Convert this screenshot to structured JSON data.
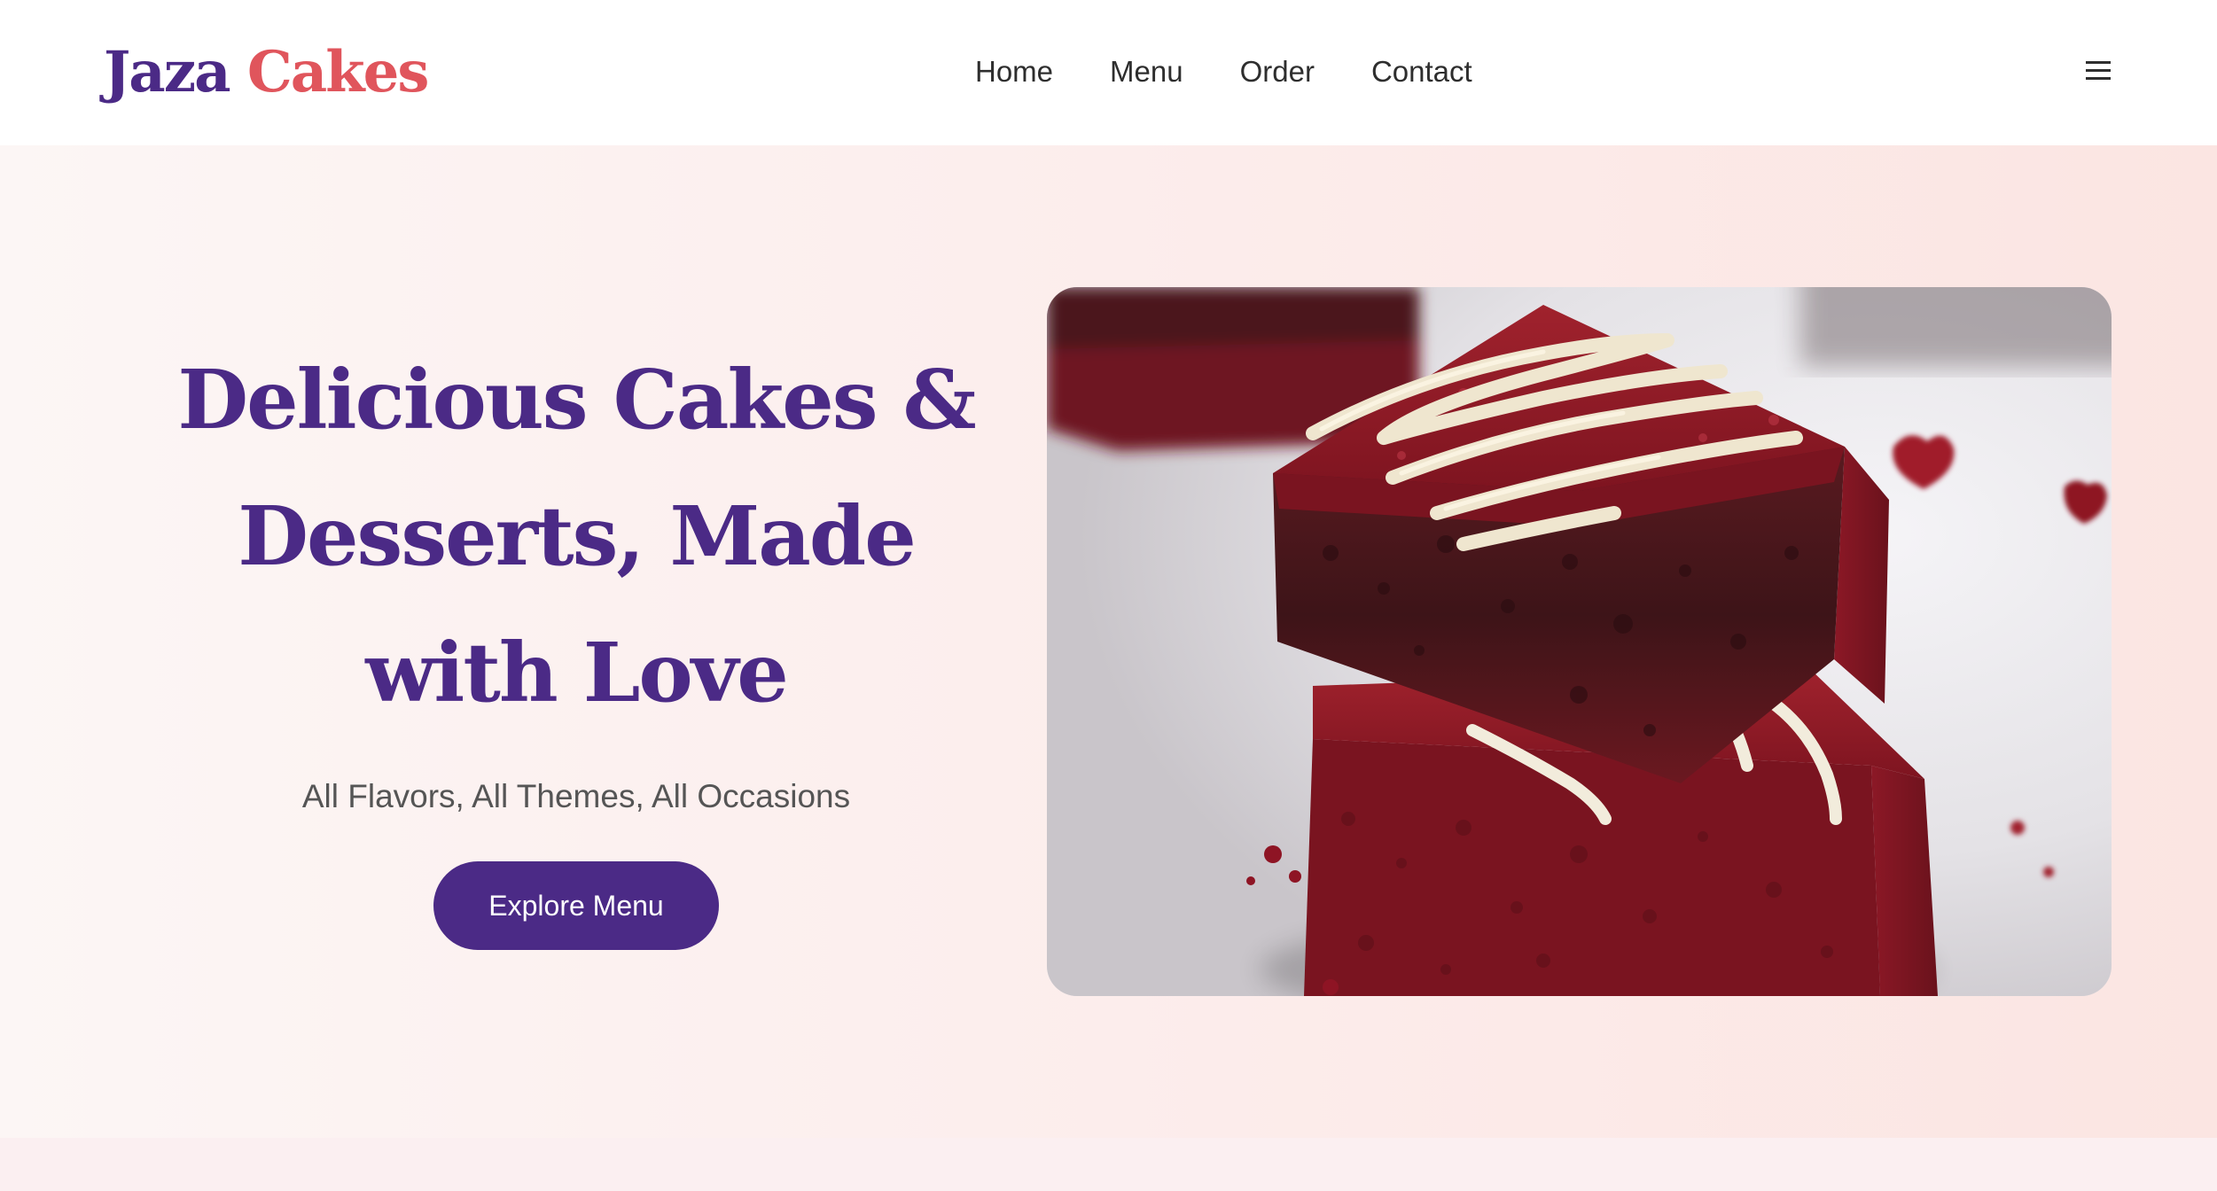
{
  "brand": {
    "name_part1": "Jaza",
    "name_part2": "Cakes"
  },
  "nav": {
    "links": [
      {
        "label": "Home"
      },
      {
        "label": "Menu"
      },
      {
        "label": "Order"
      },
      {
        "label": "Contact"
      }
    ],
    "menu_icon": "hamburger-icon"
  },
  "hero": {
    "title": "Delicious Cakes & Desserts, Made with Love",
    "subtitle": "All Flavors, All Themes, All Occasions",
    "cta_label": "Explore Menu",
    "image_icon": "red-velvet-brownies-image"
  },
  "colors": {
    "brand_purple": "#4b2a86",
    "brand_coral": "#e0555c",
    "hero_bg_start": "#fcf6f5",
    "hero_bg_end": "#fbe5e2",
    "text_dark": "#2e2e2e",
    "text_muted": "#555555"
  }
}
